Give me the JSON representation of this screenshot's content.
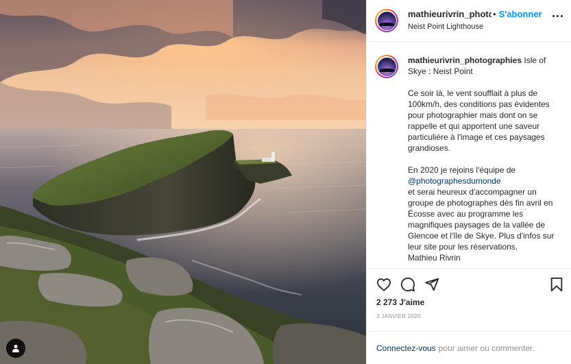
{
  "post": {
    "username": "mathieurivrin_photographies",
    "header_username": "mathieurivrin_photo",
    "separator": "•",
    "follow_label": "S'abonner",
    "location": "Neist Point Lighthouse"
  },
  "caption": {
    "username": "mathieurivrin_photographies",
    "title": "Isle of Skye : Neist Point",
    "paragraph1": "Ce soir là, le vent soufflait à plus de 100km/h, des conditions pas évidentes pour photographier mais dont on se rappelle et qui apportent une saveur particulière à l'image et ces paysages grandioses.",
    "paragraph2_intro": "En 2020 je rejoins l'équipe de",
    "mention": "@photographesdumonde",
    "paragraph2_rest": "et serai heureux d'accompagner un groupe de photographes dès fin avril en Écosse avec au programme les magnifiques paysages de la vallée de Glencoe et l'île de Skye. Plus d'infos sur leur site pour les réservations.",
    "signature": "Mathieu Rivrin"
  },
  "stats": {
    "likes": "2 273 J'aime",
    "date": "3 JANVIER 2020"
  },
  "login": {
    "link": "Connectez-vous",
    "text": "pour aimer ou commenter."
  },
  "icons": {
    "like": "heart-icon",
    "comment": "comment-icon",
    "share": "paper-plane-icon",
    "save": "bookmark-icon",
    "tag": "user-tag-icon",
    "more": "more-options-icon"
  },
  "colors": {
    "accent": "#0095f6",
    "link": "#00376b",
    "muted": "#8e8e8e",
    "text": "#262626"
  }
}
